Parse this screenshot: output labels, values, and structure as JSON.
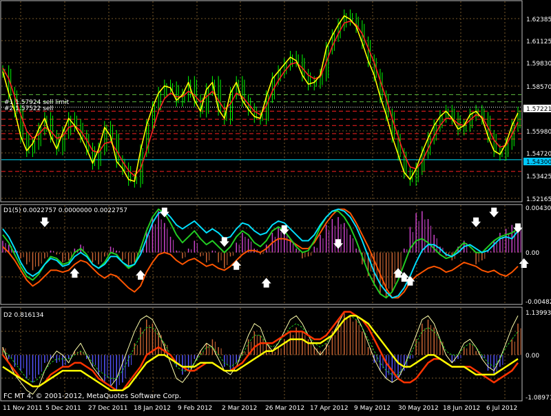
{
  "colors": {
    "background": "#000000",
    "grid": "#7a5a2a",
    "frame": "#bfbfbf",
    "axis_text": "#ffffff",
    "candle": "#00ff00",
    "ma_yellow": "#ffff00",
    "ma_red": "#ff2020",
    "level_red": "#ff2020",
    "level_green": "#60c040",
    "price_line": "#ffffff",
    "cyan_line": "#00e0ff",
    "cyan_badge": "#00c8ff",
    "histo_magenta": "#cc44cc",
    "histo_orange": "#cc6633",
    "histo_blue": "#5555ff",
    "osc_green": "#22cc22",
    "osc_orange": "#ff5500",
    "arrow": "#ffffff",
    "d2_orange_line": "#ff3300",
    "d2_white_line": "#ffffff"
  },
  "main_panel": {
    "order_label_1": "#1 1.57924 sell limit",
    "order_label_2": "#2 1.57522 sell",
    "current_price": "1.57221",
    "cyan_level": "1.54300",
    "price_axis": [
      "1.62385",
      "1.61125",
      "1.59830",
      "1.58570",
      "1.57221",
      "1.55980",
      "1.54720",
      "1.54300",
      "1.53425",
      "1.52165"
    ]
  },
  "d1_panel": {
    "title": "D1(5) 0.0022757 0.0000000 0.0022757",
    "axis": [
      "0.004303",
      "0.00",
      "-0.004823"
    ]
  },
  "d2_panel": {
    "title": "D2 0.816134",
    "axis": [
      "1.139935",
      "0.00",
      "-1.089711"
    ]
  },
  "footer": {
    "copyright": "FC MT 4, © 2001-2012, MetaQuotes Software Corp."
  },
  "time_axis": [
    "11 Nov 2011",
    "5 Dec 2011",
    "27 Dec 2011",
    "18 Jan 2012",
    "9 Feb 2012",
    "2 Mar 2012",
    "26 Mar 2012",
    "17 Apr 2012",
    "9 May 2012",
    "30 May 2012",
    "18 Jun 2012",
    "6 Jul 2012"
  ],
  "chart_data": {
    "type": "line",
    "note_free": true,
    "main": {
      "close": [
        1.592,
        1.58,
        1.57,
        1.556,
        1.548,
        1.552,
        1.56,
        1.566,
        1.556,
        1.549,
        1.558,
        1.566,
        1.562,
        1.556,
        1.549,
        1.541,
        1.549,
        1.561,
        1.556,
        1.542,
        1.538,
        1.532,
        1.531,
        1.548,
        1.562,
        1.572,
        1.58,
        1.584,
        1.583,
        1.576,
        1.579,
        1.586,
        1.576,
        1.57,
        1.582,
        1.586,
        1.571,
        1.566,
        1.58,
        1.586,
        1.576,
        1.571,
        1.567,
        1.566,
        1.578,
        1.588,
        1.592,
        1.596,
        1.6,
        1.598,
        1.59,
        1.585,
        1.586,
        1.59,
        1.605,
        1.612,
        1.618,
        1.623,
        1.621,
        1.617,
        1.608,
        1.598,
        1.59,
        1.578,
        1.568,
        1.556,
        1.546,
        1.536,
        1.532,
        1.538,
        1.547,
        1.555,
        1.562,
        1.567,
        1.57,
        1.566,
        1.56,
        1.562,
        1.568,
        1.57,
        1.566,
        1.556,
        1.548,
        1.546,
        1.552,
        1.562,
        1.569
      ],
      "ma_red": [
        1.594,
        1.588,
        1.578,
        1.568,
        1.559,
        1.555,
        1.557,
        1.561,
        1.559,
        1.555,
        1.556,
        1.561,
        1.562,
        1.559,
        1.554,
        1.548,
        1.547,
        1.552,
        1.553,
        1.548,
        1.542,
        1.537,
        1.534,
        1.538,
        1.548,
        1.559,
        1.57,
        1.577,
        1.58,
        1.578,
        1.578,
        1.581,
        1.579,
        1.575,
        1.578,
        1.581,
        1.576,
        1.571,
        1.574,
        1.58,
        1.578,
        1.574,
        1.57,
        1.568,
        1.573,
        1.581,
        1.587,
        1.592,
        1.596,
        1.597,
        1.594,
        1.59,
        1.588,
        1.589,
        1.597,
        1.606,
        1.613,
        1.619,
        1.62,
        1.618,
        1.613,
        1.605,
        1.597,
        1.587,
        1.577,
        1.566,
        1.556,
        1.546,
        1.539,
        1.538,
        1.542,
        1.549,
        1.556,
        1.562,
        1.566,
        1.566,
        1.563,
        1.562,
        1.565,
        1.568,
        1.567,
        1.561,
        1.554,
        1.55,
        1.551,
        1.557,
        1.564
      ],
      "levels_red": [
        1.57,
        1.5655,
        1.562,
        1.5575,
        1.5545,
        1.5365
      ],
      "levels_green": [
        1.5792,
        1.5752
      ],
      "cyan": 1.543,
      "ylim": [
        1.52,
        1.631
      ]
    },
    "d1": {
      "ylim": [
        -0.0052,
        0.0048
      ],
      "histogram": [
        0.0012,
        0.0008,
        0.0002,
        -0.0006,
        -0.0012,
        -0.0018,
        -0.0014,
        -0.0006,
        0.0002,
        -0.0002,
        -0.001,
        -0.0008,
        0.0004,
        0.0008,
        0.0,
        -0.001,
        -0.0012,
        -0.0004,
        0.0006,
        0.0002,
        -0.0008,
        -0.0014,
        -0.001,
        0.0006,
        0.0022,
        0.0036,
        0.0042,
        0.003,
        0.0016,
        0.0002,
        -0.0006,
        0.0004,
        0.0012,
        -0.0004,
        -0.001,
        0.0002,
        -0.001,
        -0.0016,
        -0.0004,
        0.001,
        0.002,
        0.0014,
        0.0004,
        -0.0002,
        0.0008,
        0.002,
        0.0026,
        0.0022,
        0.0014,
        0.0004,
        -0.0006,
        -0.0004,
        0.0006,
        0.0018,
        0.0028,
        0.0034,
        0.0036,
        0.003,
        0.0018,
        0.0004,
        -0.0012,
        -0.0024,
        -0.0034,
        -0.0042,
        -0.0046,
        -0.004,
        -0.0022,
        0.0004,
        0.0026,
        0.004,
        0.0042,
        0.0034,
        0.0018,
        0.0006,
        -0.0004,
        -0.0008,
        0.0006,
        0.0012,
        0.0,
        -0.0012,
        -0.0008,
        0.0002,
        0.0012,
        0.002,
        0.0024,
        0.0028,
        0.0028
      ],
      "cyan": [
        0.0024,
        0.0016,
        0.0004,
        -0.001,
        -0.002,
        -0.0024,
        -0.002,
        -0.0012,
        -0.0006,
        -0.0008,
        -0.0014,
        -0.0012,
        -0.0004,
        0.0,
        -0.0004,
        -0.0012,
        -0.0016,
        -0.0012,
        -0.0004,
        -0.0004,
        -0.001,
        -0.0014,
        -0.0012,
        -0.0002,
        0.0014,
        0.003,
        0.004,
        0.0042,
        0.0036,
        0.0028,
        0.0024,
        0.0028,
        0.0032,
        0.0026,
        0.002,
        0.0024,
        0.002,
        0.0014,
        0.0016,
        0.0024,
        0.003,
        0.0028,
        0.0022,
        0.0018,
        0.002,
        0.0028,
        0.0032,
        0.003,
        0.0024,
        0.0018,
        0.0012,
        0.0012,
        0.0018,
        0.0028,
        0.0036,
        0.0042,
        0.0044,
        0.0042,
        0.0036,
        0.0026,
        0.0012,
        -0.0004,
        -0.002,
        -0.0032,
        -0.004,
        -0.0046,
        -0.0044,
        -0.0036,
        -0.0024,
        -0.001,
        0.0002,
        0.0008,
        0.0008,
        0.0004,
        -0.0002,
        -0.0004,
        0.0,
        0.0006,
        0.0008,
        0.0004,
        0.0,
        0.0002,
        0.0008,
        0.0014,
        0.0016,
        0.0014,
        0.0022
      ],
      "green": [
        0.0018,
        0.001,
        -0.0002,
        -0.0014,
        -0.0024,
        -0.0028,
        -0.0022,
        -0.0012,
        -0.0004,
        -0.0006,
        -0.0012,
        -0.001,
        0.0,
        0.0004,
        -0.0002,
        -0.0012,
        -0.0016,
        -0.001,
        0.0,
        -0.0002,
        -0.001,
        -0.0016,
        -0.0012,
        0.0004,
        0.0022,
        0.0036,
        0.0044,
        0.004,
        0.003,
        0.0018,
        0.001,
        0.0016,
        0.0022,
        0.0014,
        0.0008,
        0.0012,
        0.0006,
        0.0,
        0.0006,
        0.0016,
        0.0022,
        0.0018,
        0.001,
        0.0006,
        0.0012,
        0.0022,
        0.0026,
        0.0022,
        0.0014,
        0.0006,
        0.0,
        0.0002,
        0.0012,
        0.0026,
        0.0036,
        0.0042,
        0.0042,
        0.0036,
        0.0026,
        0.0012,
        -0.0004,
        -0.002,
        -0.0032,
        -0.0042,
        -0.0046,
        -0.004,
        -0.0028,
        -0.0012,
        0.0004,
        0.0012,
        0.0014,
        0.001,
        0.0004,
        -0.0002,
        -0.0006,
        -0.0004,
        0.0004,
        0.001,
        0.0006,
        0.0,
        0.0,
        0.0006,
        0.0012,
        0.0016,
        0.0018,
        0.002,
        0.0024
      ],
      "orange": [
        0.0006,
        0.0,
        -0.0008,
        -0.0018,
        -0.0028,
        -0.0034,
        -0.003,
        -0.0024,
        -0.0018,
        -0.0018,
        -0.002,
        -0.0018,
        -0.0012,
        -0.0008,
        -0.001,
        -0.0016,
        -0.0022,
        -0.0026,
        -0.0022,
        -0.0024,
        -0.003,
        -0.0036,
        -0.004,
        -0.0034,
        -0.002,
        -0.001,
        -0.0002,
        0.0,
        -0.0002,
        -0.0008,
        -0.0012,
        -0.0008,
        -0.0006,
        -0.001,
        -0.0014,
        -0.0012,
        -0.0016,
        -0.0018,
        -0.0014,
        -0.0008,
        -0.0002,
        0.0002,
        0.0002,
        0.0,
        0.0004,
        0.001,
        0.0014,
        0.0014,
        0.0012,
        0.0008,
        0.0004,
        0.0004,
        0.001,
        0.002,
        0.003,
        0.0038,
        0.0044,
        0.0044,
        0.004,
        0.003,
        0.0018,
        0.0006,
        -0.0008,
        -0.0022,
        -0.0036,
        -0.0046,
        -0.0046,
        -0.004,
        -0.003,
        -0.0024,
        -0.002,
        -0.0016,
        -0.0014,
        -0.0016,
        -0.002,
        -0.0018,
        -0.0014,
        -0.001,
        -0.0012,
        -0.0014,
        -0.0018,
        -0.002,
        -0.0018,
        -0.0022,
        -0.0024,
        -0.002,
        -0.0014
      ],
      "arrows_down": [
        {
          "i": 7,
          "v": 0.003
        },
        {
          "i": 27,
          "v": 0.004
        },
        {
          "i": 37,
          "v": 0.001
        },
        {
          "i": 47,
          "v": 0.0022
        },
        {
          "i": 56,
          "v": 0.0008
        },
        {
          "i": 79,
          "v": 0.003
        },
        {
          "i": 82,
          "v": 0.004
        },
        {
          "i": 86,
          "v": 0.0024
        }
      ],
      "arrows_up": [
        {
          "i": 12,
          "v": -0.002
        },
        {
          "i": 23,
          "v": -0.0022
        },
        {
          "i": 39,
          "v": -0.0012
        },
        {
          "i": 44,
          "v": -0.003
        },
        {
          "i": 66,
          "v": -0.002
        },
        {
          "i": 67,
          "v": -0.0024
        },
        {
          "i": 68,
          "v": -0.0028
        },
        {
          "i": 87,
          "v": -0.001
        }
      ]
    },
    "d2": {
      "ylim": [
        -1.15,
        1.2
      ],
      "histogram": [
        0.2,
        -0.1,
        -0.3,
        -0.4,
        -0.6,
        -0.7,
        -0.5,
        -0.2,
        -0.1,
        -0.2,
        -0.3,
        -0.1,
        0.1,
        0.1,
        -0.1,
        -0.3,
        -0.5,
        -0.7,
        -0.8,
        -0.9,
        -0.7,
        -0.3,
        0.3,
        0.7,
        0.9,
        0.8,
        0.6,
        0.3,
        0.0,
        -0.3,
        -0.5,
        -0.4,
        -0.1,
        0.1,
        0.3,
        0.4,
        0.2,
        -0.3,
        -0.4,
        -0.2,
        0.1,
        0.4,
        0.6,
        0.5,
        0.3,
        0.1,
        0.2,
        0.4,
        0.6,
        0.7,
        0.6,
        0.4,
        0.2,
        0.1,
        0.3,
        0.6,
        0.9,
        1.1,
        1.0,
        0.9,
        0.6,
        0.2,
        -0.2,
        -0.4,
        -0.6,
        -0.7,
        -0.6,
        -0.4,
        -0.1,
        0.4,
        0.8,
        0.9,
        0.7,
        0.4,
        0.0,
        -0.2,
        -0.1,
        0.2,
        0.3,
        0.1,
        -0.1,
        -0.4,
        -0.5,
        -0.3,
        0.0,
        0.4,
        0.8
      ],
      "white": [
        0.2,
        -0.2,
        -0.5,
        -0.7,
        -0.9,
        -1.0,
        -0.8,
        -0.4,
        -0.1,
        0.1,
        0.0,
        -0.2,
        0.1,
        0.3,
        0.0,
        -0.3,
        -0.5,
        -0.7,
        -0.8,
        -0.6,
        -0.2,
        0.2,
        0.6,
        0.9,
        1.0,
        0.9,
        0.6,
        0.2,
        -0.2,
        -0.6,
        -0.7,
        -0.5,
        -0.2,
        0.1,
        0.3,
        0.2,
        -0.1,
        -0.4,
        -0.5,
        -0.3,
        0.1,
        0.5,
        0.8,
        0.7,
        0.3,
        0.1,
        0.3,
        0.6,
        0.9,
        1.0,
        0.8,
        0.5,
        0.2,
        0.0,
        0.2,
        0.5,
        0.8,
        1.1,
        1.1,
        1.0,
        0.7,
        0.3,
        -0.1,
        -0.4,
        -0.6,
        -0.7,
        -0.6,
        -0.3,
        0.1,
        0.5,
        0.9,
        1.0,
        0.8,
        0.4,
        0.0,
        -0.2,
        0.0,
        0.3,
        0.4,
        0.2,
        -0.1,
        -0.3,
        -0.4,
        -0.1,
        0.3,
        0.7,
        1.0
      ],
      "green_dash": [
        0.1,
        0.0,
        -0.2,
        -0.4,
        -0.6,
        -0.7,
        -0.6,
        -0.4,
        -0.2,
        -0.1,
        -0.1,
        -0.1,
        0.0,
        0.1,
        0.0,
        -0.2,
        -0.4,
        -0.5,
        -0.6,
        -0.6,
        -0.4,
        -0.1,
        0.2,
        0.5,
        0.7,
        0.7,
        0.5,
        0.3,
        0.0,
        -0.3,
        -0.4,
        -0.4,
        -0.2,
        0.0,
        0.2,
        0.2,
        0.0,
        -0.2,
        -0.3,
        -0.2,
        0.0,
        0.3,
        0.5,
        0.5,
        0.3,
        0.2,
        0.3,
        0.5,
        0.7,
        0.8,
        0.7,
        0.5,
        0.3,
        0.2,
        0.3,
        0.5,
        0.7,
        0.9,
        1.0,
        0.9,
        0.7,
        0.4,
        0.1,
        -0.2,
        -0.4,
        -0.5,
        -0.5,
        -0.3,
        0.0,
        0.3,
        0.6,
        0.7,
        0.6,
        0.4,
        0.1,
        0.0,
        0.0,
        0.2,
        0.3,
        0.2,
        0.0,
        -0.2,
        -0.3,
        -0.1,
        0.2,
        0.4,
        0.6
      ],
      "yellow": [
        -0.3,
        -0.4,
        -0.5,
        -0.6,
        -0.7,
        -0.8,
        -0.8,
        -0.7,
        -0.6,
        -0.5,
        -0.4,
        -0.4,
        -0.4,
        -0.4,
        -0.5,
        -0.6,
        -0.7,
        -0.8,
        -0.9,
        -0.9,
        -0.9,
        -0.8,
        -0.6,
        -0.4,
        -0.2,
        -0.1,
        0.0,
        0.0,
        -0.1,
        -0.2,
        -0.3,
        -0.3,
        -0.3,
        -0.2,
        -0.2,
        -0.2,
        -0.3,
        -0.4,
        -0.4,
        -0.4,
        -0.3,
        -0.2,
        -0.1,
        0.0,
        0.1,
        0.1,
        0.2,
        0.3,
        0.4,
        0.4,
        0.4,
        0.3,
        0.3,
        0.3,
        0.4,
        0.5,
        0.7,
        0.9,
        1.0,
        1.0,
        0.9,
        0.8,
        0.6,
        0.4,
        0.2,
        0.0,
        -0.2,
        -0.3,
        -0.3,
        -0.2,
        -0.1,
        0.0,
        0.0,
        -0.1,
        -0.2,
        -0.3,
        -0.3,
        -0.3,
        -0.4,
        -0.5,
        -0.5,
        -0.5,
        -0.5,
        -0.4,
        -0.3,
        -0.2,
        -0.1
      ],
      "red": [
        0.0,
        -0.2,
        -0.4,
        -0.6,
        -0.7,
        -0.8,
        -0.8,
        -0.7,
        -0.5,
        -0.4,
        -0.3,
        -0.3,
        -0.2,
        -0.2,
        -0.3,
        -0.4,
        -0.6,
        -0.7,
        -0.8,
        -0.9,
        -0.9,
        -0.7,
        -0.5,
        -0.3,
        0.0,
        0.1,
        0.2,
        0.1,
        0.0,
        -0.2,
        -0.3,
        -0.4,
        -0.4,
        -0.3,
        -0.2,
        -0.2,
        -0.3,
        -0.4,
        -0.4,
        -0.3,
        -0.2,
        0.0,
        0.2,
        0.3,
        0.3,
        0.3,
        0.4,
        0.5,
        0.6,
        0.6,
        0.6,
        0.5,
        0.4,
        0.4,
        0.5,
        0.7,
        0.9,
        1.1,
        1.1,
        1.0,
        0.9,
        0.7,
        0.4,
        0.1,
        -0.2,
        -0.4,
        -0.6,
        -0.7,
        -0.7,
        -0.6,
        -0.4,
        -0.2,
        -0.1,
        -0.1,
        -0.2,
        -0.3,
        -0.3,
        -0.3,
        -0.3,
        -0.4,
        -0.5,
        -0.6,
        -0.7,
        -0.6,
        -0.5,
        -0.4,
        -0.2
      ]
    }
  }
}
